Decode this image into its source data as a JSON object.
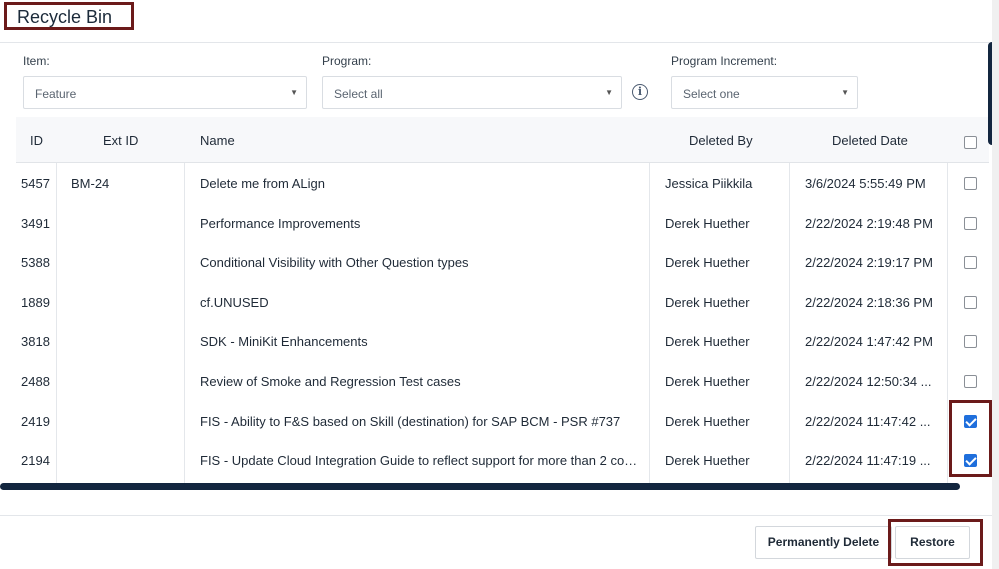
{
  "dialog": {
    "title": "Recycle Bin"
  },
  "filters": {
    "item": {
      "label": "Item:",
      "value": "Feature"
    },
    "program": {
      "label": "Program:",
      "value": "Select all"
    },
    "program_increment": {
      "label": "Program Increment:",
      "value": "Select one"
    },
    "info_icon": "info-circle-icon"
  },
  "table": {
    "columns": [
      "ID",
      "Ext ID",
      "Name",
      "Deleted By",
      "Deleted Date"
    ],
    "rows": [
      {
        "id": "5457",
        "ext_id": "BM-24",
        "name": "Delete me from ALign",
        "deleted_by": "Jessica Piikkila",
        "deleted_date": "3/6/2024 5:55:49 PM",
        "checked": false
      },
      {
        "id": "3491",
        "ext_id": "",
        "name": "Performance Improvements",
        "deleted_by": "Derek Huether",
        "deleted_date": "2/22/2024 2:19:48 PM",
        "checked": false
      },
      {
        "id": "5388",
        "ext_id": "",
        "name": "Conditional Visibility with Other Question types",
        "deleted_by": "Derek Huether",
        "deleted_date": "2/22/2024 2:19:17 PM",
        "checked": false
      },
      {
        "id": "1889",
        "ext_id": "",
        "name": "cf.UNUSED",
        "deleted_by": "Derek Huether",
        "deleted_date": "2/22/2024 2:18:36 PM",
        "checked": false
      },
      {
        "id": "3818",
        "ext_id": "",
        "name": "SDK - MiniKit Enhancements",
        "deleted_by": "Derek Huether",
        "deleted_date": "2/22/2024 1:47:42 PM",
        "checked": false
      },
      {
        "id": "2488",
        "ext_id": "",
        "name": "Review of Smoke and Regression Test cases",
        "deleted_by": "Derek Huether",
        "deleted_date": "2/22/2024 12:50:34 ...",
        "checked": false
      },
      {
        "id": "2419",
        "ext_id": "",
        "name": "FIS - Ability to F&S based on Skill (destination) for SAP BCM - PSR #737",
        "deleted_by": "Derek Huether",
        "deleted_date": "2/22/2024 11:47:42 ...",
        "checked": true
      },
      {
        "id": "2194",
        "ext_id": "",
        "name": "FIS - Update Cloud Integration Guide to reflect support for more than 2 con...",
        "deleted_by": "Derek Huether",
        "deleted_date": "2/22/2024 11:47:19 ...",
        "checked": true
      }
    ]
  },
  "footer": {
    "permanently_delete_label": "Permanently Delete",
    "restore_label": "Restore"
  },
  "colors": {
    "accent": "#1f6fdc",
    "highlight_frame": "#6b1a1a",
    "scrollbar": "#13263f"
  }
}
